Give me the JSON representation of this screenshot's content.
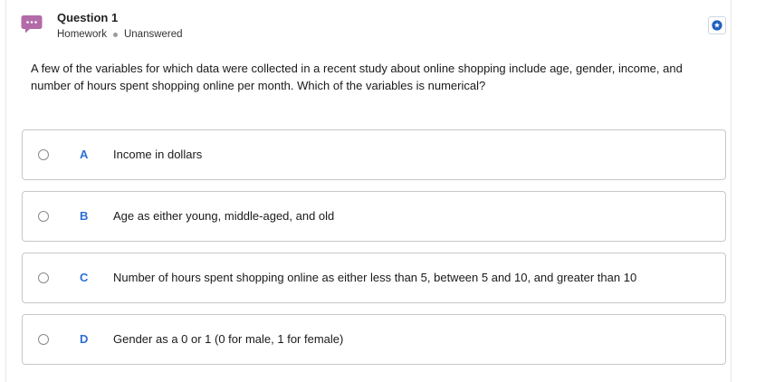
{
  "question": {
    "title": "Question 1",
    "category": "Homework",
    "status": "Unanswered",
    "text": "A few of the variables for which data were collected in a recent study about online shopping include age, gender, income, and number of hours spent shopping online per month. Which of the variables is numerical?"
  },
  "options": [
    {
      "letter": "A",
      "label": "Income in dollars"
    },
    {
      "letter": "B",
      "label": "Age as either young, middle-aged, and old"
    },
    {
      "letter": "C",
      "label": "Number of hours spent shopping online as either less than 5, between 5 and 10, and greater than 10"
    },
    {
      "letter": "D",
      "label": "Gender as a 0 or 1 (0 for male, 1 for female)"
    }
  ],
  "icons": {
    "question": "chat-bubble-icon",
    "bookmark": "star-bookmark-icon",
    "separator": "dot-separator"
  },
  "colors": {
    "chat_icon": "#b26aa8",
    "letter": "#2c6fd6",
    "bookmark_star": "#1f5fbf",
    "border": "#c8c8c8"
  }
}
